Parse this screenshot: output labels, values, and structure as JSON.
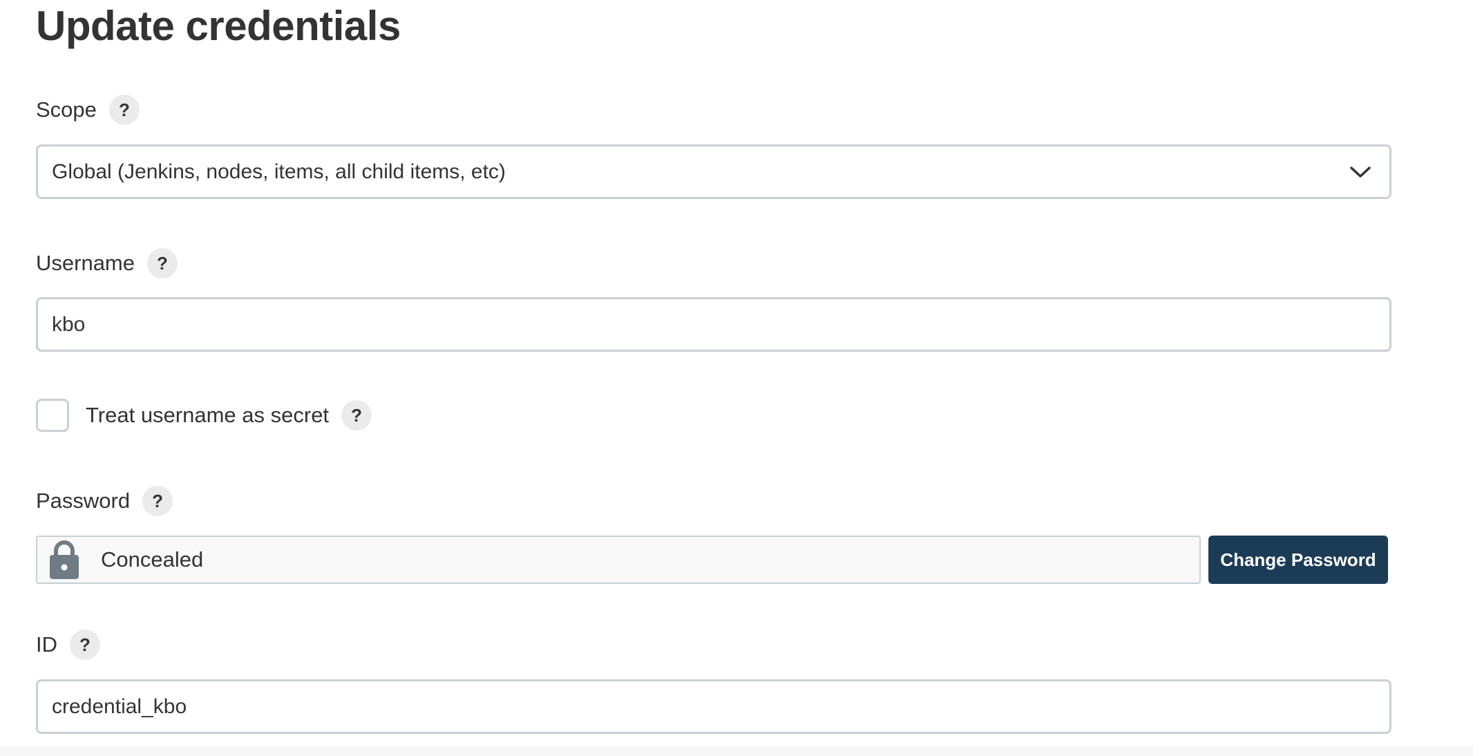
{
  "page": {
    "title": "Update credentials"
  },
  "scope": {
    "label": "Scope",
    "help": "?",
    "value": "Global (Jenkins, nodes, items, all child items, etc)"
  },
  "username": {
    "label": "Username",
    "help": "?",
    "value": "kbo"
  },
  "treat_secret": {
    "label": "Treat username as secret",
    "help": "?",
    "checked": false
  },
  "password": {
    "label": "Password",
    "help": "?",
    "value": "Concealed",
    "change_button": "Change Password"
  },
  "id_field": {
    "label": "ID",
    "help": "?",
    "value": "credential_kbo"
  },
  "colors": {
    "primary_button": "#1c3b57",
    "input_border": "#c9d0d3",
    "help_bg": "#ebebeb",
    "lock_icon": "#6f7b85"
  },
  "icons": {
    "scope_dropdown": "chevron-down-icon",
    "password": "lock-icon",
    "help": "question-mark-icon"
  }
}
